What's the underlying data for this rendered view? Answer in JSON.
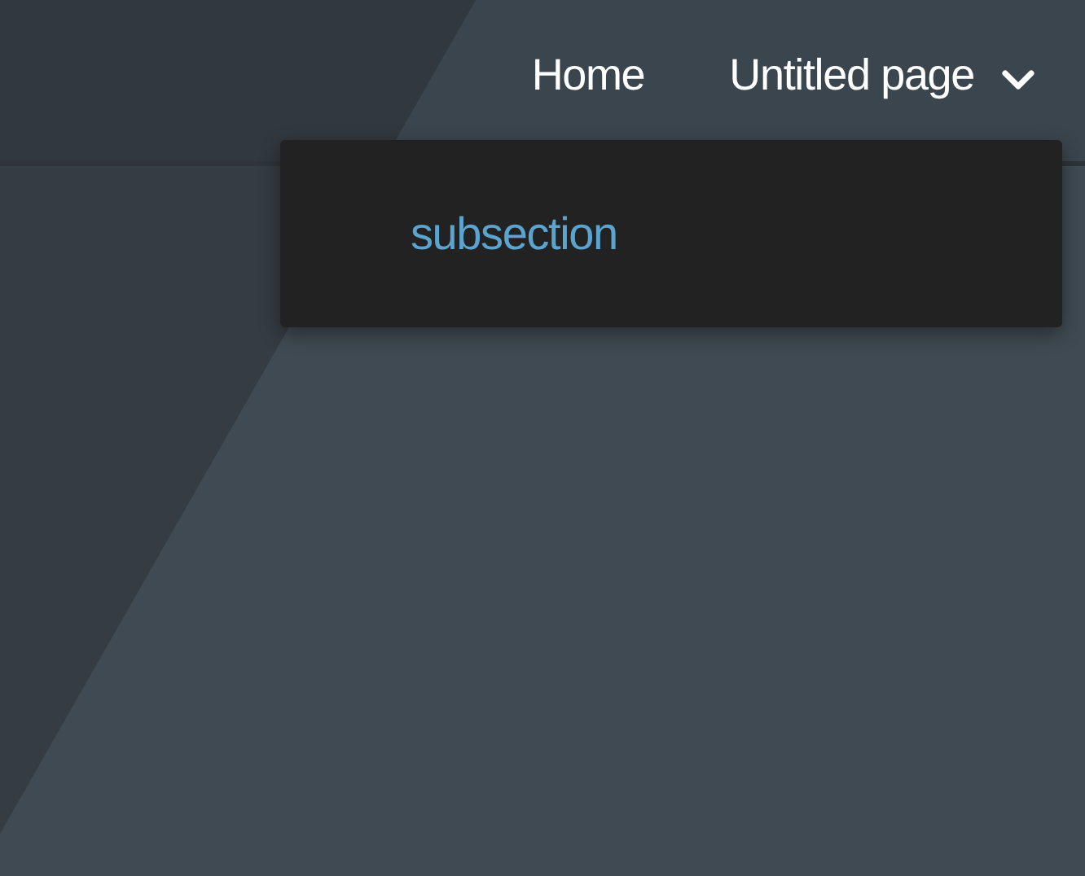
{
  "nav": {
    "items": [
      {
        "label": "Home",
        "kind": "link"
      },
      {
        "label": "Untitled page",
        "kind": "dropdown",
        "expanded": true,
        "children": [
          {
            "label": "subsection"
          }
        ]
      }
    ]
  }
}
